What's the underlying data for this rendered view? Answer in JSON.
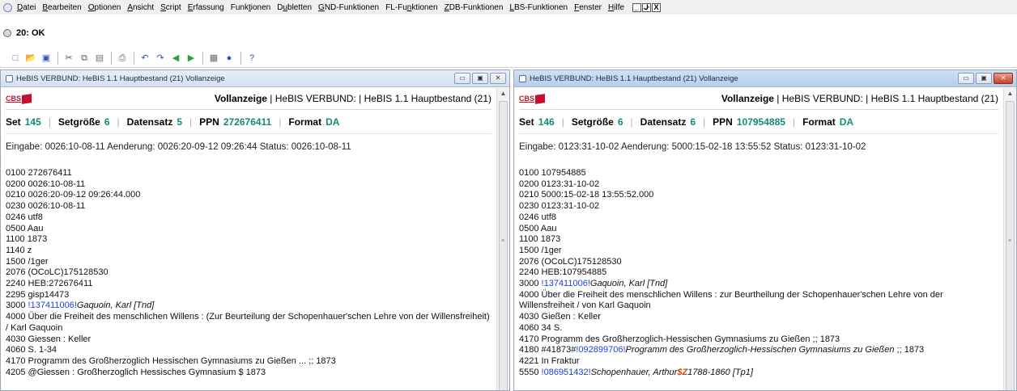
{
  "menubar": {
    "items": [
      {
        "pre": "",
        "u": "D",
        "post": "atei"
      },
      {
        "pre": "",
        "u": "B",
        "post": "earbeiten"
      },
      {
        "pre": "",
        "u": "O",
        "post": "ptionen"
      },
      {
        "pre": "",
        "u": "A",
        "post": "nsicht"
      },
      {
        "pre": "",
        "u": "S",
        "post": "cript"
      },
      {
        "pre": "",
        "u": "E",
        "post": "rfassung"
      },
      {
        "pre": "Funk",
        "u": "t",
        "post": "ionen"
      },
      {
        "pre": "D",
        "u": "u",
        "post": "bletten"
      },
      {
        "pre": "",
        "u": "G",
        "post": "ND-Funktionen"
      },
      {
        "pre": "FL-Fu",
        "u": "n",
        "post": "ktionen"
      },
      {
        "pre": "",
        "u": "Z",
        "post": "DB-Funktionen"
      },
      {
        "pre": "",
        "u": "L",
        "post": "BS-Funktionen"
      },
      {
        "pre": "",
        "u": "F",
        "post": "enster"
      },
      {
        "pre": "",
        "u": "H",
        "post": "ilfe"
      }
    ],
    "window_controls": [
      "_",
      "ᒙ",
      "X"
    ]
  },
  "status": {
    "text": "20: OK"
  },
  "toolbar": {
    "groups": [
      [
        "new-icon",
        "open-icon",
        "save-icon"
      ],
      [
        "cut-icon",
        "copy-icon",
        "paste-icon"
      ],
      [
        "print-icon"
      ],
      [
        "undo-icon",
        "redo-icon",
        "back-icon",
        "forward-icon"
      ],
      [
        "record-icon",
        "info-icon"
      ],
      [
        "help-icon"
      ]
    ]
  },
  "panes": [
    {
      "title": "HeBIS VERBUND: HeBIS 1.1 Hauptbestand (21) Vollanzeige",
      "logo_text": "CBS",
      "header": {
        "bold": "Vollanzeige",
        "rest": " | HeBIS VERBUND:  | HeBIS 1.1 Hauptbestand (21)"
      },
      "set": {
        "set_label": "Set",
        "set_val": "145",
        "size_label": "Setgröße",
        "size_val": "6",
        "rec_label": "Datensatz",
        "rec_val": "5",
        "ppn_label": "PPN",
        "ppn_val": "272676411",
        "fmt_label": "Format",
        "fmt_val": "DA"
      },
      "eingabe": "Eingabe: 0026:10-08-11 Aenderung: 0026:20-09-12 09:26:44 Status: 0026:10-08-11",
      "lines": [
        [
          {
            "t": "0100 272676411"
          }
        ],
        [
          {
            "t": "0200 0026:10-08-11"
          }
        ],
        [
          {
            "t": "0210 0026:20-09-12 09:26:44.000"
          }
        ],
        [
          {
            "t": "0230 0026:10-08-11"
          }
        ],
        [
          {
            "t": "0246 utf8"
          }
        ],
        [
          {
            "t": "0500 Aau"
          }
        ],
        [
          {
            "t": "1100 1873"
          }
        ],
        [
          {
            "t": "1140 z"
          }
        ],
        [
          {
            "t": "1500 /1ger"
          }
        ],
        [
          {
            "t": "2076 (OCoLC)175128530"
          }
        ],
        [
          {
            "t": "2240 HEB:272676411"
          }
        ],
        [
          {
            "t": "2295 gisp14473"
          }
        ],
        [
          {
            "t": "3000 "
          },
          {
            "t": "!137411006!",
            "c": "link"
          },
          {
            "t": "Gaquoin, Karl [Tnd]",
            "c": "ital"
          }
        ],
        [
          {
            "t": "4000 Über die Freiheit des menschlichen Willens : (Zur Beurteilung der Schopenhauer'schen Lehre von der Willensfreiheit) / Karl Gaquoin"
          }
        ],
        [
          {
            "t": "4030 Giessen : Keller"
          }
        ],
        [
          {
            "t": "4060 S. 1-34"
          }
        ],
        [
          {
            "t": "4170 Programm des Großherzoglich Hessischen Gymnasiums zu Gießen ... ;; 1873"
          }
        ],
        [
          {
            "t": "4205 @Giessen : Großherzoglich Hessisches Gymnasium $ 1873"
          }
        ]
      ]
    },
    {
      "title": "HeBIS VERBUND: HeBIS 1.1 Hauptbestand (21) Vollanzeige",
      "logo_text": "CBS",
      "header": {
        "bold": "Vollanzeige",
        "rest": " | HeBIS VERBUND:  | HeBIS 1.1 Hauptbestand (21)"
      },
      "set": {
        "set_label": "Set",
        "set_val": "146",
        "size_label": "Setgröße",
        "size_val": "6",
        "rec_label": "Datensatz",
        "rec_val": "6",
        "ppn_label": "PPN",
        "ppn_val": "107954885",
        "fmt_label": "Format",
        "fmt_val": "DA"
      },
      "eingabe": "Eingabe: 0123:31-10-02 Aenderung: 5000:15-02-18 13:55:52 Status: 0123:31-10-02",
      "lines": [
        [
          {
            "t": "0100 107954885"
          }
        ],
        [
          {
            "t": "0200 0123:31-10-02"
          }
        ],
        [
          {
            "t": "0210 5000:15-02-18 13:55:52.000"
          }
        ],
        [
          {
            "t": "0230 0123:31-10-02"
          }
        ],
        [
          {
            "t": "0246 utf8"
          }
        ],
        [
          {
            "t": "0500 Aau"
          }
        ],
        [
          {
            "t": "1100 1873"
          }
        ],
        [
          {
            "t": "1500 /1ger"
          }
        ],
        [
          {
            "t": "2076 (OCoLC)175128530"
          }
        ],
        [
          {
            "t": "2240 HEB:107954885"
          }
        ],
        [
          {
            "t": "3000 "
          },
          {
            "t": "!137411006!",
            "c": "link"
          },
          {
            "t": "Gaquoin, Karl [Tnd]",
            "c": "ital"
          }
        ],
        [
          {
            "t": "4000 Über die Freiheit des menschlichen Willens : zur Beurtheilung der Schopenhauer'schen Lehre von der Willensfreiheit / von Karl Gaquoin"
          }
        ],
        [
          {
            "t": "4030 Gießen : Keller"
          }
        ],
        [
          {
            "t": "4060 34 S."
          }
        ],
        [
          {
            "t": "4170 Programm des Großherzoglich-Hessischen Gymnasiums zu Gießen ;; 1873"
          }
        ],
        [
          {
            "t": "4180 #41873#"
          },
          {
            "t": "!092899706!",
            "c": "link"
          },
          {
            "t": "Programm des Großherzoglich-Hessischen Gymnasiums zu Gießen",
            "c": "ital"
          },
          {
            "t": " ;; 1873"
          }
        ],
        [
          {
            "t": "4221 In Fraktur"
          }
        ],
        [
          {
            "t": "5550 "
          },
          {
            "t": "!086951432!",
            "c": "link"
          },
          {
            "t": "Schopenhauer, Arthur",
            "c": "ital"
          },
          {
            "t": "$Z",
            "c": "subf"
          },
          {
            "t": "1788-1860 [Tp1]",
            "c": "ital"
          }
        ]
      ]
    }
  ]
}
